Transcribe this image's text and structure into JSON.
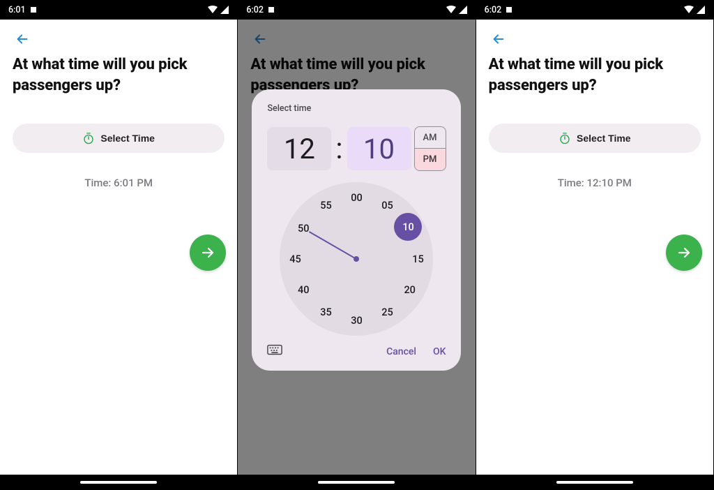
{
  "screens": [
    {
      "status_time": "6:01",
      "question": "At what time will you pick passengers up?",
      "select_btn": "Select Time",
      "time_label": "Time: 6:01 PM"
    },
    {
      "status_time": "6:02",
      "question": "At what time will you pick passengers up?",
      "dialog": {
        "title": "Select time",
        "hour": "12",
        "minute": "10",
        "am": "AM",
        "pm": "PM",
        "selected_period": "PM",
        "cancel": "Cancel",
        "ok": "OK",
        "clock_numbers": [
          "00",
          "05",
          "10",
          "15",
          "20",
          "25",
          "30",
          "35",
          "40",
          "45",
          "50",
          "55"
        ],
        "selected_minute": "10"
      }
    },
    {
      "status_time": "6:02",
      "question": "At what time will you pick passengers up?",
      "select_btn": "Select Time",
      "time_label": "Time: 12:10 PM"
    }
  ],
  "colors": {
    "accent_green": "#3bb24c",
    "clock_purple": "#6750a4",
    "back_blue": "#2a8bd7"
  }
}
